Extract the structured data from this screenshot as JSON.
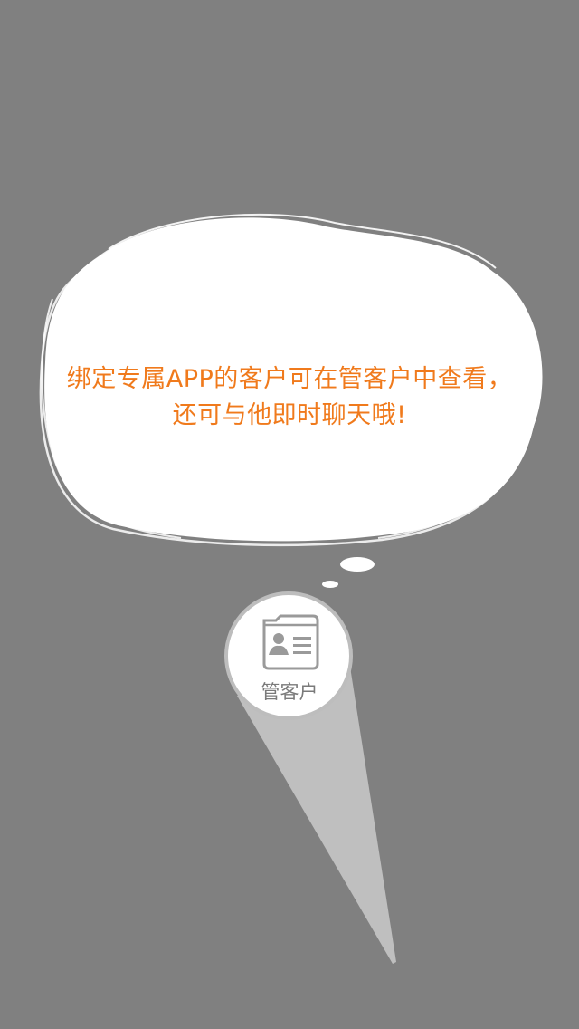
{
  "tip": {
    "line1": "绑定专属APP的客户可在管客户中查看，",
    "line2": "还可与他即时聊天哦!"
  },
  "feature": {
    "label": "管客户",
    "icon": "contact-card-icon"
  },
  "colors": {
    "overlay": "#808080",
    "tip_text": "#f07a1c",
    "bubble_fill": "#ffffff",
    "beam": "#bfbfbf"
  }
}
